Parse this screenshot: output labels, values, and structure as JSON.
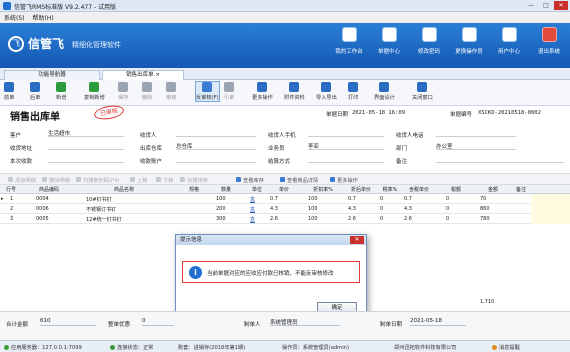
{
  "window": {
    "title": "信管飞RMS标准版 V9.2.477 - 试用版",
    "min": "—",
    "max": "□",
    "close": "✕"
  },
  "menu": [
    "系统(S)",
    "帮助(H)"
  ],
  "brand": {
    "logo_text": "信管飞",
    "tagline": "精细化管理软件",
    "logo_mark": "飞"
  },
  "topnav": [
    {
      "label": "我的工作台",
      "icon": "desk-icon"
    },
    {
      "label": "单据中心",
      "icon": "doc-center-icon"
    },
    {
      "label": "修改密码",
      "icon": "key-icon"
    },
    {
      "label": "更换操作员",
      "icon": "operator-icon"
    },
    {
      "label": "用户中心",
      "icon": "user-center-icon"
    },
    {
      "label": "退出系统",
      "icon": "power-icon"
    }
  ],
  "tabs": [
    "功能导航器",
    "销售出库单"
  ],
  "tab_close": "×",
  "toolbar": [
    {
      "label": "前单",
      "icon": "prev-icon",
      "color": "#2b6cc4"
    },
    {
      "label": "后单",
      "icon": "next-icon",
      "color": "#2b6cc4"
    },
    {
      "label": "新增",
      "icon": "add-icon",
      "color": "#2c9b3b"
    },
    {
      "label": "复制新增",
      "icon": "copy-add-icon",
      "color": "#2c9b3b"
    },
    {
      "label": "保存",
      "icon": "save-icon",
      "color": "#9aa4b0",
      "disabled": true
    },
    {
      "label": "删除",
      "icon": "delete-icon",
      "color": "#9aa4b0",
      "disabled": true
    },
    {
      "label": "审核",
      "icon": "audit-icon",
      "color": "#9aa4b0",
      "disabled": true
    },
    {
      "label": "反审核(F)",
      "icon": "unaudit-icon",
      "color": "#3a7bd5",
      "active": true
    },
    {
      "label": "引单",
      "icon": "import-order-icon",
      "color": "#9aa4b0",
      "disabled": true
    },
    {
      "label": "更多操作",
      "icon": "more-ops-icon",
      "color": "#2b6cc4"
    },
    {
      "label": "附件资料",
      "icon": "attachment-icon",
      "color": "#2b6cc4"
    },
    {
      "label": "导入导出",
      "icon": "import-export-icon",
      "color": "#2b6cc4"
    },
    {
      "label": "打印",
      "icon": "print-icon",
      "color": "#2b6cc4"
    },
    {
      "label": "界面设计",
      "icon": "ui-design-icon",
      "color": "#2b6cc4"
    },
    {
      "label": "关闭窗口",
      "icon": "close-window-icon",
      "color": "#2b6cc4"
    }
  ],
  "form": {
    "title": "销售出库单",
    "stamp": "已审核",
    "date_label": "单据日期",
    "date_value": "2021-05-18 16:09",
    "no_label": "单据编号",
    "no_value": "XSCKD-20210518-0002",
    "fields": {
      "customer_label": "客户",
      "customer_value": "生活超市",
      "receiver_label": "收货人",
      "receiver_value": "",
      "receiver_phone_label": "收货人手机",
      "receiver_phone_value": "",
      "receiver_tel_label": "收货人电话",
      "receiver_tel_value": "",
      "address_label": "收货地址",
      "address_value": "",
      "warehouse_label": "出库仓库",
      "warehouse_value": "总仓库",
      "salesman_label": "业务员",
      "salesman_value": "李亚",
      "dept_label": "部门",
      "dept_value": "办公室",
      "received_label": "本次收款",
      "received_value": "",
      "account_label": "收款账户",
      "account_value": "",
      "settle_label": "结算方式",
      "settle_value": "",
      "remark_label": "备注",
      "remark_value": ""
    }
  },
  "gridbar": [
    {
      "label": "添加明细",
      "icon": "add-row-icon",
      "disabled": true
    },
    {
      "label": "删除明细",
      "icon": "delete-row-icon",
      "disabled": true
    },
    {
      "label": "扫描条形码(F4)",
      "icon": "barcode-icon",
      "disabled": true
    },
    {
      "label": "上移",
      "icon": "up-icon",
      "disabled": true
    },
    {
      "label": "下移",
      "icon": "down-icon",
      "disabled": true
    },
    {
      "label": "快捷排序",
      "icon": "sort-icon",
      "disabled": true
    },
    {
      "label": "查看库存",
      "icon": "stock-icon"
    },
    {
      "label": "查看商品详情",
      "icon": "goods-detail-icon"
    },
    {
      "label": "更多操作",
      "icon": "more-icon"
    }
  ],
  "grid": {
    "headers": [
      "行号",
      "商品编码",
      "商品名称",
      "规格",
      "数量",
      "单位",
      "单价",
      "折扣率%",
      "折后单价",
      "税率%",
      "含税单价",
      "税额",
      "金额",
      "备注"
    ],
    "rows": [
      {
        "no": "1",
        "code": "0004",
        "name": "10#钉书钉",
        "spec": "",
        "qty": "100",
        "unit": "盒",
        "price": "0.7",
        "disc": "100",
        "dprice": "0.7",
        "tax": "0",
        "tprice": "0.7",
        "taxamt": "0",
        "amount": "70",
        "remark": ""
      },
      {
        "no": "2",
        "code": "0006",
        "name": "不锈钢订书钉",
        "spec": "",
        "qty": "200",
        "unit": "盒",
        "price": "4.3",
        "disc": "100",
        "dprice": "4.3",
        "tax": "0",
        "tprice": "4.3",
        "taxamt": "0",
        "amount": "860",
        "remark": ""
      },
      {
        "no": "3",
        "code": "0005",
        "name": "12#统一钉书钉",
        "spec": "",
        "qty": "300",
        "unit": "盒",
        "price": "2.6",
        "disc": "100",
        "dprice": "2.6",
        "tax": "0",
        "tprice": "2.6",
        "taxamt": "0",
        "amount": "780",
        "remark": ""
      }
    ],
    "qty_total": "600",
    "amount_total": "1,710",
    "row_marker": "▸"
  },
  "dialog": {
    "title": "提示信息",
    "message": "当前单据对应的应收应付款已核销，不能反审核修改",
    "ok": "确定",
    "info_glyph": "i"
  },
  "footer": {
    "total_label": "合计金额",
    "total_value": "610",
    "round_label": "整单优惠",
    "round_value": "0",
    "maker_label": "制单人",
    "maker_value": "系统管理员",
    "make_date_label": "制单日期",
    "make_date_value": "2021-05-18"
  },
  "status": {
    "server": "应用服务器：127.0.0.1:7099",
    "conn": "连接状态：正常",
    "book": "账套：进销存(2018年第1期)",
    "operator": "操作员：系统管理员(admin)",
    "company": "郑州迅拓软件科技有限公司",
    "msg": "消息提醒"
  }
}
